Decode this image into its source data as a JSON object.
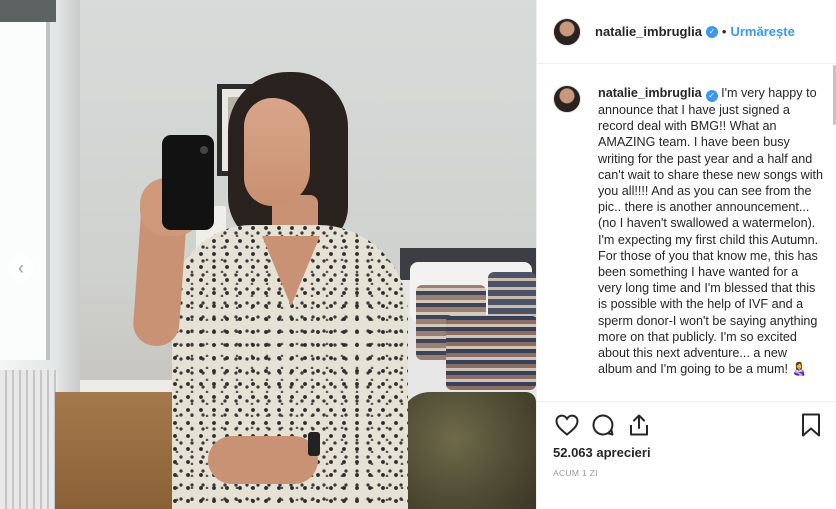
{
  "post": {
    "username": "natalie_imbruglia",
    "verified_icon": "verified-badge-icon",
    "separator": "•",
    "follow_label": "Urmărește",
    "caption": "I'm very happy to announce that I have just signed a record deal with BMG!! What an AMAZING team. I have been busy writing for the past year and a half and can't wait to share these new songs with you all!!!! And as you can see from the pic.. there is another announcement... (no I haven't swallowed a watermelon). I'm expecting my first child this Autumn. For those of you that know me, this has been something I have wanted for a very long time and I'm blessed that this is possible with the help of IVF and a sperm donor-I won't be saying anything more on that publicly. I'm so excited about this next adventure... a new album and I'm going to be a mum! 👩‍🍼",
    "likes_text": "52.063 aprecieri",
    "time_text": "ACUM 1 ZI"
  },
  "photo": {
    "prev_glyph": "‹"
  },
  "icons": {
    "like": "heart-icon",
    "comment": "comment-icon",
    "share": "share-icon",
    "save": "bookmark-icon"
  },
  "colors": {
    "accent": "#3897f0",
    "text": "#262626",
    "muted": "#999999",
    "border": "#efefef"
  }
}
